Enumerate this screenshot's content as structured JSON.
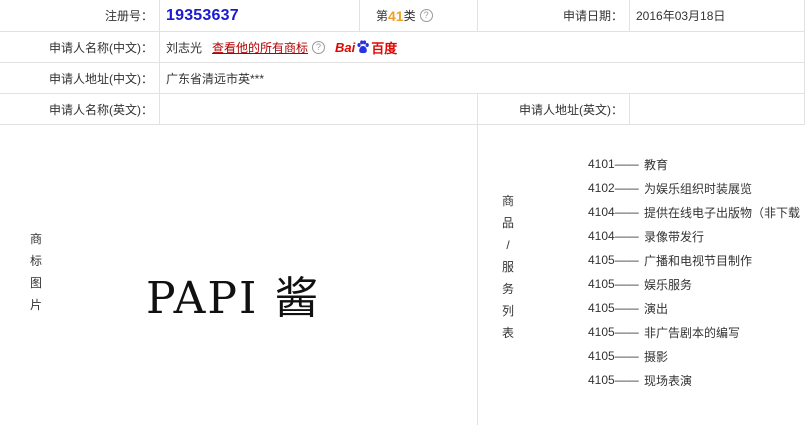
{
  "reg": {
    "label": "注册号：",
    "number": "19353637",
    "class_prefix": "第",
    "class_num": "41",
    "class_suffix": "类",
    "date_label": "申请日期：",
    "date": "2016年03月18日"
  },
  "applicant": {
    "name_cn_label": "申请人名称(中文)：",
    "name_cn": "刘志光",
    "view_all_link": "查看他的所有商标",
    "baidu_bai": "Bai",
    "baidu_du": "百度",
    "addr_cn_label": "申请人地址(中文)：",
    "addr_cn": "广东省清远市英***",
    "name_en_label": "申请人名称(英文)：",
    "name_en": "",
    "addr_en_label": "申请人地址(英文)：",
    "addr_en": ""
  },
  "mark": {
    "label_chars": [
      "商",
      "标",
      "图",
      "片"
    ],
    "text": "PAPI 酱"
  },
  "services": {
    "label_chars": [
      "商",
      "品",
      "/",
      "服",
      "务",
      "列",
      "表"
    ],
    "items": [
      {
        "code": "4101——",
        "name": "教育"
      },
      {
        "code": "4102——",
        "name": "为娱乐组织时装展览"
      },
      {
        "code": "4104——",
        "name": "提供在线电子出版物（非下载"
      },
      {
        "code": "4104——",
        "name": "录像带发行"
      },
      {
        "code": "4105——",
        "name": "广播和电视节目制作"
      },
      {
        "code": "4105——",
        "name": "娱乐服务"
      },
      {
        "code": "4105——",
        "name": "演出"
      },
      {
        "code": "4105——",
        "name": "非广告剧本的编写"
      },
      {
        "code": "4105——",
        "name": "摄影"
      },
      {
        "code": "4105——",
        "name": "现场表演"
      }
    ]
  },
  "colors": {
    "reg_number": "#1a1ad0",
    "class_number": "#f0a020",
    "link": "#b00000",
    "baidu": "#e10602",
    "border": "#e2e2e2"
  }
}
